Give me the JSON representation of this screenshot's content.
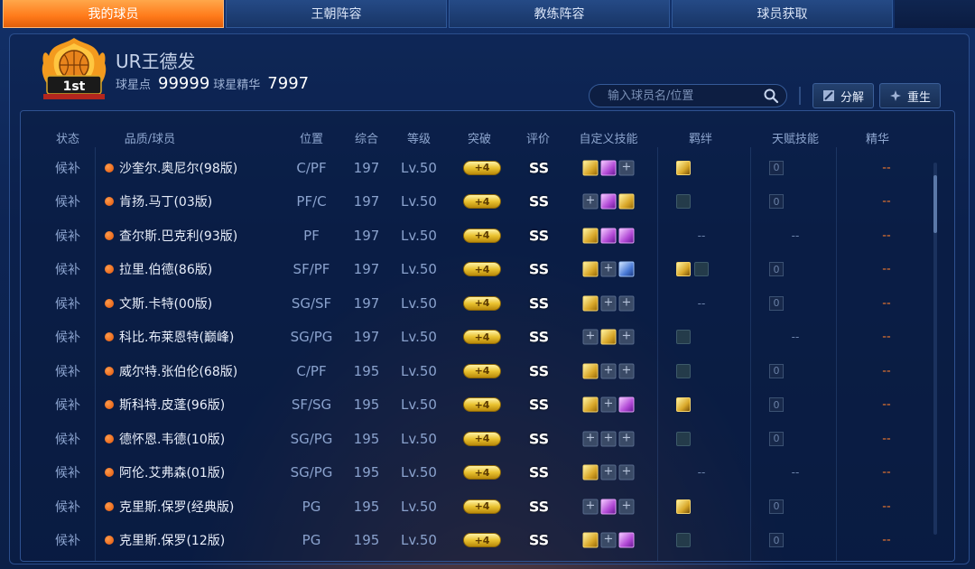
{
  "tabs": [
    {
      "label": "我的球员",
      "active": true
    },
    {
      "label": "王朝阵容",
      "active": false
    },
    {
      "label": "教练阵容",
      "active": false
    },
    {
      "label": "球员获取",
      "active": false
    }
  ],
  "profile": {
    "name": "UR王德发",
    "star_points_label": "球星点",
    "star_points_value": "99999",
    "essence_label": "球星精华",
    "essence_value": "7997",
    "badge_text": "1st"
  },
  "search": {
    "placeholder": "输入球员名/位置"
  },
  "actions": {
    "decompose": "分解",
    "rebirth": "重生"
  },
  "columns": {
    "status": "状态",
    "player": "品质/球员",
    "position": "位置",
    "overall": "综合",
    "level": "等级",
    "breakthrough": "突破",
    "rating": "评价",
    "custom_skills": "自定义技能",
    "bonds": "羁绊",
    "talent": "天赋技能",
    "essence": "精华"
  },
  "rows": [
    {
      "status": "候补",
      "name": "沙奎尔.奥尼尔(98版)",
      "pos": "C/PF",
      "score": "197",
      "level": "Lv.50",
      "break": "+4",
      "rating": "SS",
      "skills": [
        "gold",
        "purple",
        "empty"
      ],
      "bonds": [
        "gold"
      ],
      "bond_dash": "",
      "talent": "0",
      "talent_dash": "",
      "essence": "--"
    },
    {
      "status": "候补",
      "name": "肯扬.马丁(03版)",
      "pos": "PF/C",
      "score": "197",
      "level": "Lv.50",
      "break": "+4",
      "rating": "SS",
      "skills": [
        "empty",
        "purple",
        "gold"
      ],
      "bonds": [
        "dim"
      ],
      "bond_dash": "",
      "talent": "0",
      "talent_dash": "",
      "essence": "--"
    },
    {
      "status": "候补",
      "name": "查尔斯.巴克利(93版)",
      "pos": "PF",
      "score": "197",
      "level": "Lv.50",
      "break": "+4",
      "rating": "SS",
      "skills": [
        "gold",
        "purple",
        "purple"
      ],
      "bonds": [],
      "bond_dash": "--",
      "talent": "",
      "talent_dash": "--",
      "essence": "--"
    },
    {
      "status": "候补",
      "name": "拉里.伯德(86版)",
      "pos": "SF/PF",
      "score": "197",
      "level": "Lv.50",
      "break": "+4",
      "rating": "SS",
      "skills": [
        "gold",
        "empty",
        "blue"
      ],
      "bonds": [
        "gold",
        "dim"
      ],
      "bond_dash": "",
      "talent": "0",
      "talent_dash": "",
      "essence": "--"
    },
    {
      "status": "候补",
      "name": "文斯.卡特(00版)",
      "pos": "SG/SF",
      "score": "197",
      "level": "Lv.50",
      "break": "+4",
      "rating": "SS",
      "skills": [
        "gold",
        "empty",
        "empty"
      ],
      "bonds": [],
      "bond_dash": "--",
      "talent": "0",
      "talent_dash": "",
      "essence": "--"
    },
    {
      "status": "候补",
      "name": "科比.布莱恩特(巅峰)",
      "pos": "SG/PG",
      "score": "197",
      "level": "Lv.50",
      "break": "+4",
      "rating": "SS",
      "skills": [
        "empty",
        "gold",
        "empty"
      ],
      "bonds": [
        "dim"
      ],
      "bond_dash": "",
      "talent": "",
      "talent_dash": "--",
      "essence": "--"
    },
    {
      "status": "候补",
      "name": "威尔特.张伯伦(68版)",
      "pos": "C/PF",
      "score": "195",
      "level": "Lv.50",
      "break": "+4",
      "rating": "SS",
      "skills": [
        "gold",
        "empty",
        "empty"
      ],
      "bonds": [
        "dim"
      ],
      "bond_dash": "",
      "talent": "0",
      "talent_dash": "",
      "essence": "--"
    },
    {
      "status": "候补",
      "name": "斯科特.皮蓬(96版)",
      "pos": "SF/SG",
      "score": "195",
      "level": "Lv.50",
      "break": "+4",
      "rating": "SS",
      "skills": [
        "gold",
        "empty",
        "purple"
      ],
      "bonds": [
        "gold"
      ],
      "bond_dash": "",
      "talent": "0",
      "talent_dash": "",
      "essence": "--"
    },
    {
      "status": "候补",
      "name": "德怀恩.韦德(10版)",
      "pos": "SG/PG",
      "score": "195",
      "level": "Lv.50",
      "break": "+4",
      "rating": "SS",
      "skills": [
        "empty",
        "empty",
        "empty"
      ],
      "bonds": [
        "dim"
      ],
      "bond_dash": "",
      "talent": "0",
      "talent_dash": "",
      "essence": "--"
    },
    {
      "status": "候补",
      "name": "阿伦.艾弗森(01版)",
      "pos": "SG/PG",
      "score": "195",
      "level": "Lv.50",
      "break": "+4",
      "rating": "SS",
      "skills": [
        "gold",
        "empty",
        "empty"
      ],
      "bonds": [],
      "bond_dash": "--",
      "talent": "",
      "talent_dash": "--",
      "essence": "--"
    },
    {
      "status": "候补",
      "name": "克里斯.保罗(经典版)",
      "pos": "PG",
      "score": "195",
      "level": "Lv.50",
      "break": "+4",
      "rating": "SS",
      "skills": [
        "empty",
        "purple",
        "empty"
      ],
      "bonds": [
        "gold"
      ],
      "bond_dash": "",
      "talent": "0",
      "talent_dash": "",
      "essence": "--"
    },
    {
      "status": "候补",
      "name": "克里斯.保罗(12版)",
      "pos": "PG",
      "score": "195",
      "level": "Lv.50",
      "break": "+4",
      "rating": "SS",
      "skills": [
        "gold",
        "empty",
        "purple"
      ],
      "bonds": [
        "dim"
      ],
      "bond_dash": "",
      "talent": "0",
      "talent_dash": "",
      "essence": "--"
    }
  ]
}
